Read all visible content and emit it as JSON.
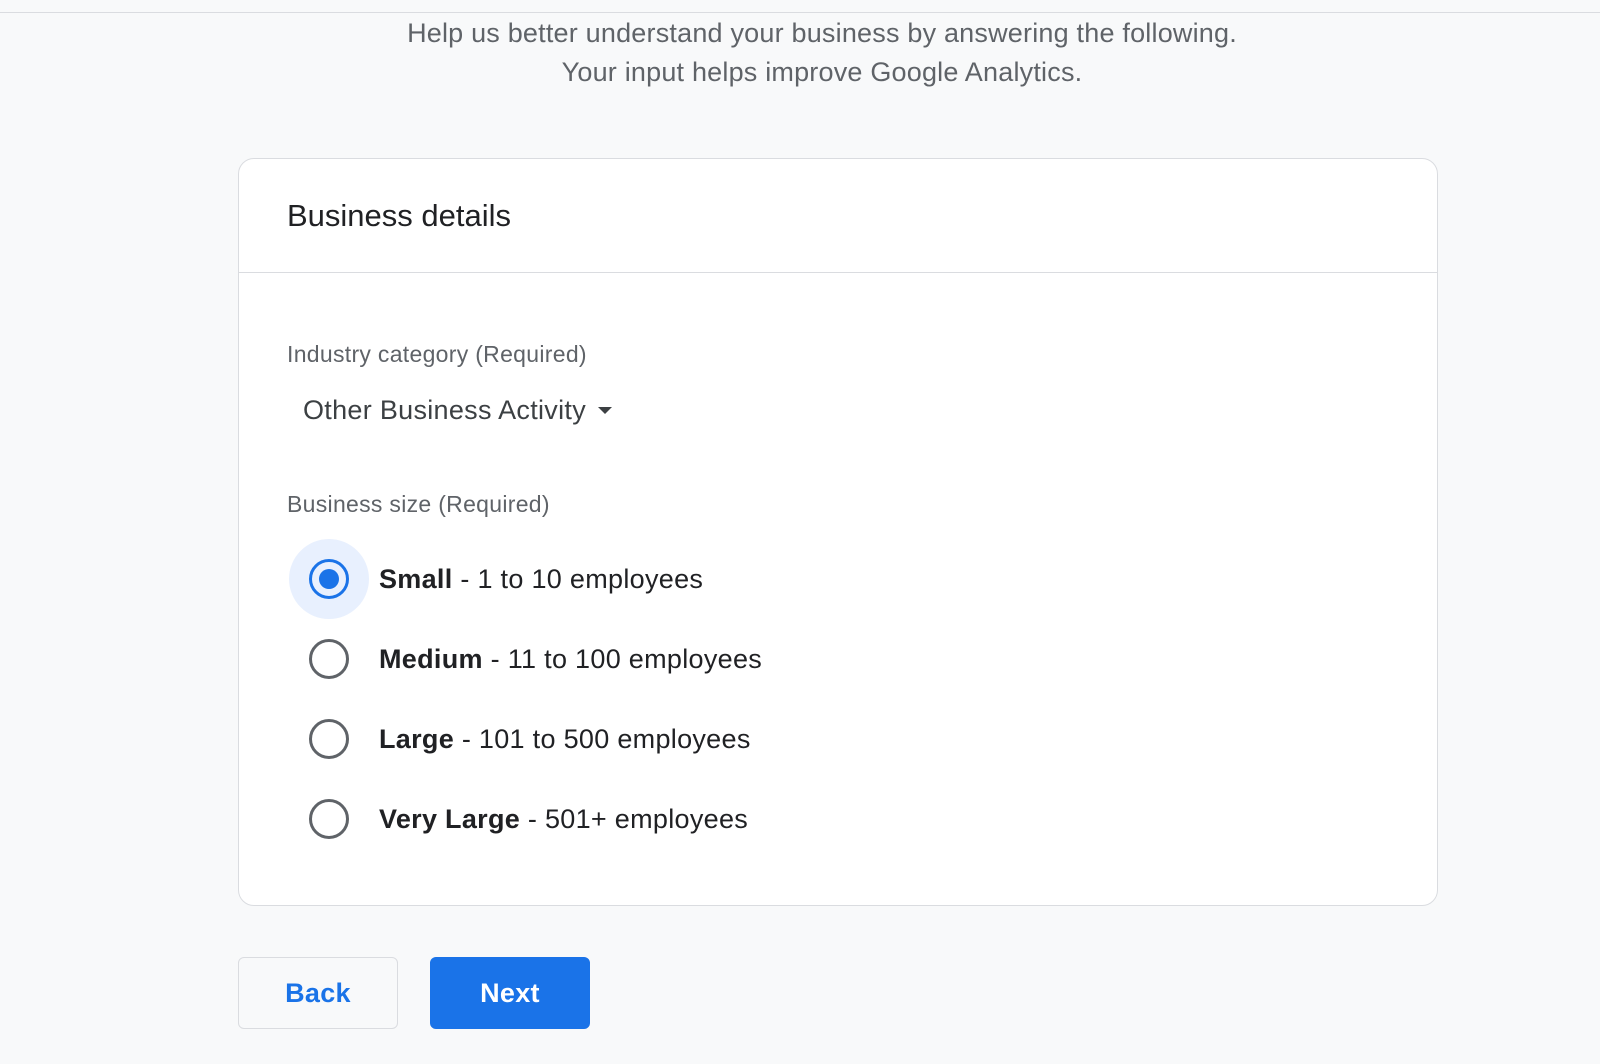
{
  "intro": {
    "line1": "Help us better understand your business by answering the following.",
    "line2": "Your input helps improve Google Analytics."
  },
  "card": {
    "title": "Business details",
    "industry": {
      "label": "Industry category (Required)",
      "selected": "Other Business Activity"
    },
    "size": {
      "label": "Business size (Required)",
      "selected_index": 0,
      "options": [
        {
          "name": "Small",
          "detail": " - 1 to 10 employees"
        },
        {
          "name": "Medium",
          "detail": " - 11 to 100 employees"
        },
        {
          "name": "Large",
          "detail": " - 101 to 500 employees"
        },
        {
          "name": "Very Large",
          "detail": " - 501+ employees"
        }
      ]
    }
  },
  "actions": {
    "back_label": "Back",
    "next_label": "Next"
  },
  "colors": {
    "accent": "#1a73e8",
    "accent_tint": "#e8f0fe",
    "background": "#f8f9fa",
    "border": "#dadce0"
  },
  "icons": {
    "dropdown": "caret-down-icon"
  }
}
